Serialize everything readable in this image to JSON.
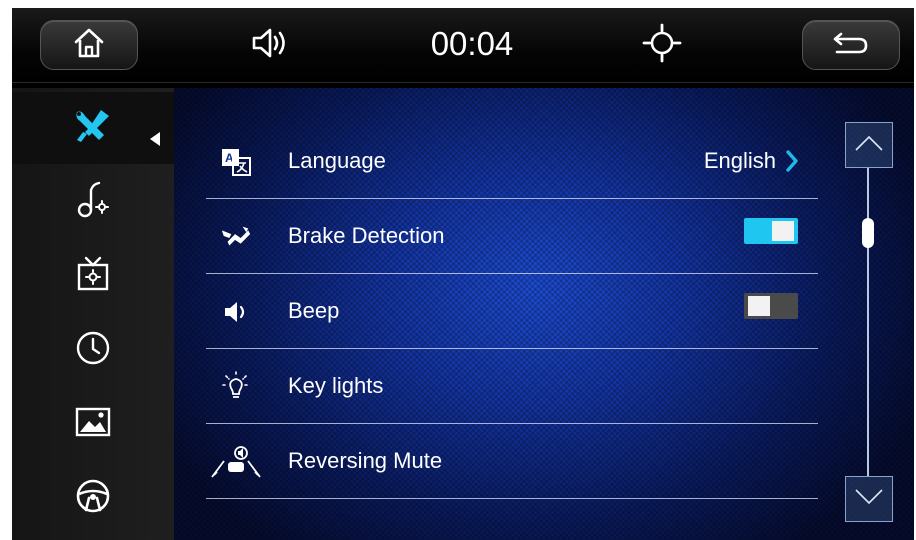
{
  "statusbar": {
    "clock": "00:04"
  },
  "settings": {
    "rows": [
      {
        "label": "Language",
        "value": "English"
      },
      {
        "label": "Brake Detection",
        "toggle": "on"
      },
      {
        "label": "Beep",
        "toggle": "off"
      },
      {
        "label": "Key lights"
      },
      {
        "label": "Reversing Mute"
      }
    ]
  },
  "colors": {
    "accent": "#1fc6f0",
    "background": "#1436a8",
    "topbar": "#000000"
  }
}
